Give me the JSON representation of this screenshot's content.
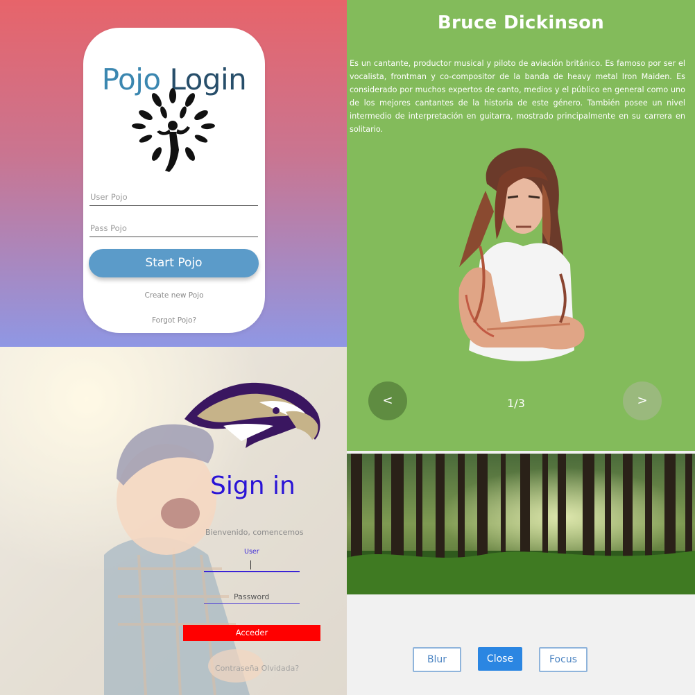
{
  "pojo_login": {
    "title_part1": "Pojo",
    "title_part2": "Login",
    "logo_icon": "tree-person-icon",
    "user_placeholder": "User Pojo",
    "pass_placeholder": "Pass Pojo",
    "start_button": "Start Pojo",
    "create_link": "Create new Pojo",
    "forgot_link": "Forgot Pojo?",
    "colors": {
      "gradient_top": "#e7646a",
      "gradient_bottom": "#8f97e4",
      "button": "#5b9bc9"
    }
  },
  "bio_slider": {
    "title": "Bruce Dickinson",
    "description": "Es un cantante, productor musical y piloto de aviación británico. Es famoso por ser el vocalista, frontman y co-compositor de la banda de heavy metal Iron Maiden. Es considerado por muchos expertos de canto, medios y el público en general como uno de los mejores cantantes de la historia de este género. También posee un nivel intermedio de interpretación en guitarra, mostrado principalmente en su carrera en solitario.",
    "prev_label": "<",
    "next_label": ">",
    "page_counter": "1/3",
    "colors": {
      "background": "#83bb5b"
    }
  },
  "forest_panel": {
    "image_icon": "forest-image",
    "buttons": {
      "blur": "Blur",
      "close": "Close",
      "focus": "Focus"
    },
    "colors": {
      "accent": "#2b86e2"
    }
  },
  "sign_in": {
    "logo_icon": "eagle-head-icon",
    "title": "Sign in",
    "subtitle": "Bienvenido, comencemos",
    "user_label": "User",
    "password_label": "Password",
    "submit_button": "Acceder",
    "forgot_link": "Contraseña Olvidada?",
    "colors": {
      "title": "#2a14d6",
      "button": "#ff0000"
    }
  }
}
